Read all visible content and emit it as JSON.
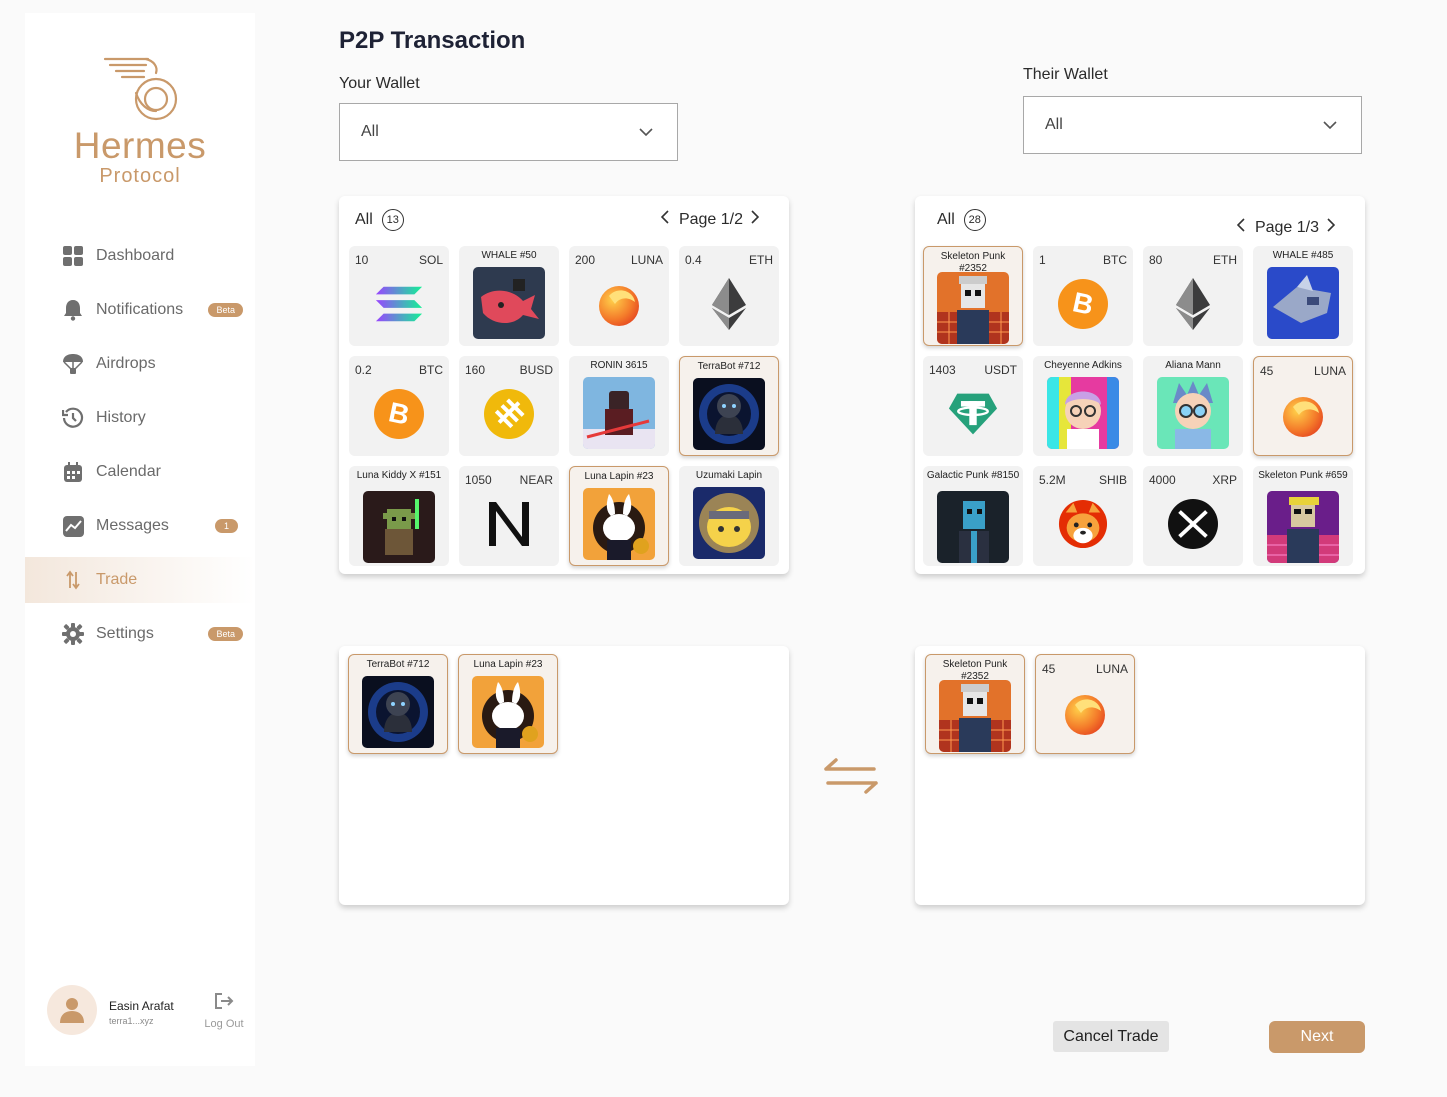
{
  "brand": {
    "name": "Hermes",
    "sub": "Protocol",
    "accent": "#c9996a"
  },
  "sidebar": {
    "items": [
      {
        "label": "Dashboard",
        "icon": "dashboard-icon",
        "badge": ""
      },
      {
        "label": "Notifications",
        "icon": "bell-icon",
        "badge": "Beta"
      },
      {
        "label": "Airdrops",
        "icon": "parachute-icon",
        "badge": ""
      },
      {
        "label": "History",
        "icon": "history-icon",
        "badge": ""
      },
      {
        "label": "Calendar",
        "icon": "calendar-icon",
        "badge": ""
      },
      {
        "label": "Messages",
        "icon": "chart-icon",
        "badge": "1"
      },
      {
        "label": "Trade",
        "icon": "trade-icon",
        "badge": "",
        "active": true
      },
      {
        "label": "Settings",
        "icon": "gear-icon",
        "badge": "Beta"
      }
    ]
  },
  "user": {
    "name": "Easin Arafat",
    "address": "terra1...xyz",
    "logout_label": "Log Out"
  },
  "page": {
    "title": "P2P Transaction"
  },
  "your_wallet": {
    "label": "Your Wallet",
    "selected": "All"
  },
  "their_wallet": {
    "label": "Their Wallet",
    "selected": "All"
  },
  "your_panel": {
    "filter": "All",
    "count": "13",
    "page": "Page 1/2",
    "items": [
      {
        "amount": "10",
        "symbol": "SOL",
        "kind": "sol"
      },
      {
        "nft": "WHALE #50",
        "kind": "whale"
      },
      {
        "amount": "200",
        "symbol": "LUNA",
        "kind": "luna"
      },
      {
        "amount": "0.4",
        "symbol": "ETH",
        "kind": "eth"
      },
      {
        "amount": "0.2",
        "symbol": "BTC",
        "kind": "btc"
      },
      {
        "amount": "160",
        "symbol": "BUSD",
        "kind": "busd"
      },
      {
        "nft": "RONIN 3615",
        "kind": "ronin"
      },
      {
        "nft": "TerraBot #712",
        "kind": "terrabot",
        "selected": true
      },
      {
        "nft": "Luna Kiddy X #151",
        "kind": "kiddy"
      },
      {
        "amount": "1050",
        "symbol": "NEAR",
        "kind": "near"
      },
      {
        "nft": "Luna Lapin #23",
        "kind": "lapin",
        "selected": true
      },
      {
        "nft": "Uzumaki Lapin",
        "kind": "uzumaki"
      }
    ]
  },
  "their_panel": {
    "filter": "All",
    "count": "28",
    "page": "Page 1/3",
    "items": [
      {
        "nft": "Skeleton Punk #2352",
        "kind": "skeleton",
        "selected": true
      },
      {
        "amount": "1",
        "symbol": "BTC",
        "kind": "btc"
      },
      {
        "amount": "80",
        "symbol": "ETH",
        "kind": "eth"
      },
      {
        "nft": "WHALE #485",
        "kind": "whale2"
      },
      {
        "amount": "1403",
        "symbol": "USDT",
        "kind": "usdt"
      },
      {
        "nft": "Cheyenne Adkins",
        "kind": "cheyenne"
      },
      {
        "nft": "Aliana Mann",
        "kind": "aliana"
      },
      {
        "amount": "45",
        "symbol": "LUNA",
        "kind": "luna",
        "selected": true
      },
      {
        "nft": "Galactic Punk #8150",
        "kind": "galactic"
      },
      {
        "amount": "5.2M",
        "symbol": "SHIB",
        "kind": "shib"
      },
      {
        "amount": "4000",
        "symbol": "XRP",
        "kind": "xrp"
      },
      {
        "nft": "Skeleton Punk #659",
        "kind": "skeleton2"
      }
    ]
  },
  "your_offer": {
    "items": [
      {
        "nft": "TerraBot #712",
        "kind": "terrabot",
        "selected": true
      },
      {
        "nft": "Luna Lapin #23",
        "kind": "lapin",
        "selected": true
      }
    ]
  },
  "their_offer": {
    "items": [
      {
        "nft": "Skeleton Punk #2352",
        "kind": "skeleton",
        "selected": true
      },
      {
        "amount": "45",
        "symbol": "LUNA",
        "kind": "luna",
        "selected": true
      }
    ]
  },
  "actions": {
    "cancel_label": "Cancel Trade",
    "next_label": "Next"
  }
}
